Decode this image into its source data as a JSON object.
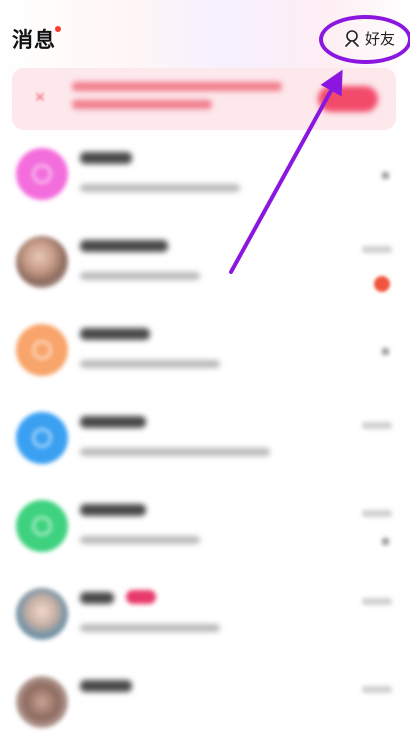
{
  "header": {
    "title": "消息",
    "friends_label": "好友"
  },
  "colors": {
    "accent_annotation": "#8a16e0",
    "notify_dot": "#ff3b30",
    "banner_bg": "#fde8ec",
    "banner_button": "#f24b6a",
    "unread_badge": "#f0543c"
  },
  "icons": {
    "friends": "person-outline-icon",
    "banner_close": "close-icon"
  },
  "list": {
    "items": [
      {
        "avatar_color": "#f36ddc"
      },
      {
        "avatar_color": "photo"
      },
      {
        "avatar_color": "#f8a46a"
      },
      {
        "avatar_color": "#3aa0f2"
      },
      {
        "avatar_color": "#3ed27f"
      },
      {
        "avatar_color": "photo"
      },
      {
        "avatar_color": "photo"
      }
    ]
  }
}
